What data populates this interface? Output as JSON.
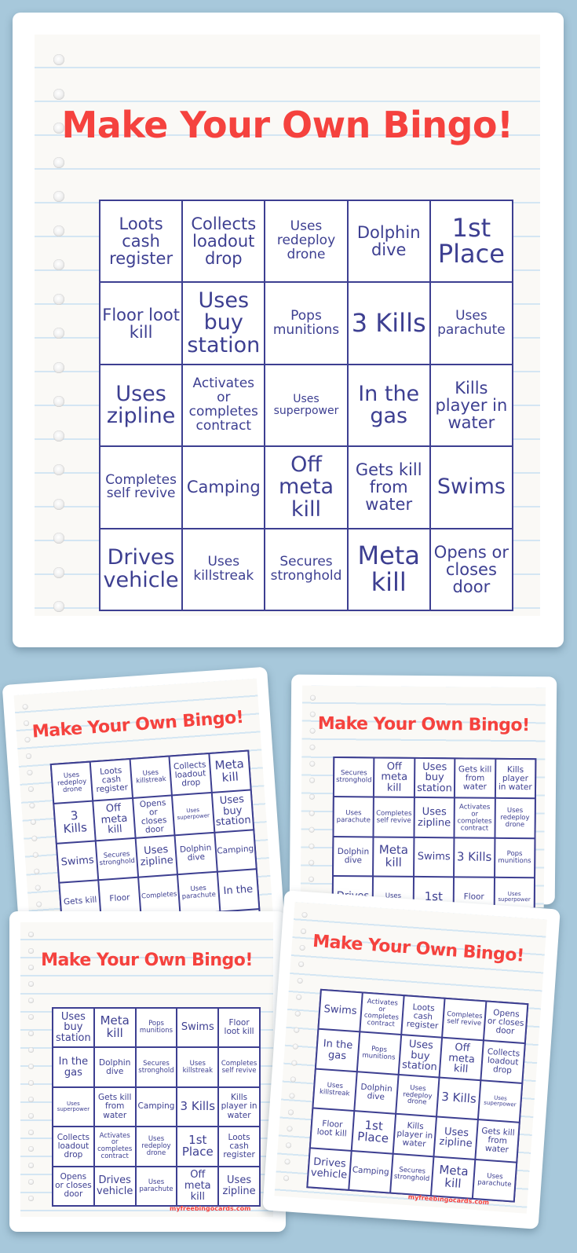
{
  "main": {
    "title": "Make Your Own Bingo!",
    "cells": [
      [
        "Loots cash register",
        "Collects loadout drop",
        "Uses redeploy drone",
        "Dolphin dive",
        "1st Place"
      ],
      [
        "Floor loot kill",
        "Uses buy station",
        "Pops munitions",
        "3 Kills",
        "Uses parachute"
      ],
      [
        "Uses zipline",
        "Activates or completes contract",
        "Uses superpower",
        "In the gas",
        "Kills player in water"
      ],
      [
        "Completes self revive",
        "Camping",
        "Off meta kill",
        "Gets kill from water",
        "Swims"
      ],
      [
        "Drives vehicle",
        "Uses killstreak",
        "Secures stronghold",
        "Meta kill",
        "Opens or closes door"
      ]
    ]
  },
  "cards": [
    {
      "title": "Make Your Own Bingo!",
      "cells": [
        [
          "Uses redeploy drone",
          "Loots cash register",
          "Uses killstreak",
          "Collects loadout drop",
          "Meta kill"
        ],
        [
          "3 Kills",
          "Off meta kill",
          "Opens or closes door",
          "Uses superpower",
          "Uses buy station"
        ],
        [
          "Swims",
          "Secures stronghold",
          "Uses zipline",
          "Dolphin dive",
          "Camping"
        ],
        [
          "Gets kill",
          "Floor",
          "Completes",
          "Uses parachute",
          "In the"
        ],
        [
          "",
          "",
          "",
          "",
          ""
        ]
      ]
    },
    {
      "title": "Make Your Own Bingo!",
      "cells": [
        [
          "Secures stronghold",
          "Off meta kill",
          "Uses buy station",
          "Gets kill from water",
          "Kills player in water"
        ],
        [
          "Uses parachute",
          "Completes self revive",
          "Uses zipline",
          "Activates or completes contract",
          "Uses redeploy drone"
        ],
        [
          "Dolphin dive",
          "Meta kill",
          "Swims",
          "3 Kills",
          "Pops munitions"
        ],
        [
          "Drives",
          "Uses",
          "1st",
          "Floor",
          "Uses superpower"
        ],
        [
          "",
          "",
          "",
          "",
          ""
        ]
      ]
    },
    {
      "title": "Make Your Own Bingo!",
      "watermark": "myfreebingocards.com",
      "cells": [
        [
          "Uses buy station",
          "Meta kill",
          "Pops munitions",
          "Swims",
          "Floor loot kill"
        ],
        [
          "In the gas",
          "Dolphin dive",
          "Secures stronghold",
          "Uses killstreak",
          "Completes self revive"
        ],
        [
          "Uses superpower",
          "Gets kill from water",
          "Camping",
          "3 Kills",
          "Kills player in water"
        ],
        [
          "Collects loadout drop",
          "Activates or completes contract",
          "Uses redeploy drone",
          "1st Place",
          "Loots cash register"
        ],
        [
          "Opens or closes door",
          "Drives vehicle",
          "Uses parachute",
          "Off meta kill",
          "Uses zipline"
        ]
      ]
    },
    {
      "title": "Make Your Own Bingo!",
      "watermark": "myfreebingocards.com",
      "cells": [
        [
          "Swims",
          "Activates or completes contract",
          "Loots cash register",
          "Completes self revive",
          "Opens or closes door"
        ],
        [
          "In the gas",
          "Pops munitions",
          "Uses buy station",
          "Off meta kill",
          "Collects loadout drop"
        ],
        [
          "Uses killstreak",
          "Dolphin dive",
          "Uses redeploy drone",
          "3 Kills",
          "Uses superpower"
        ],
        [
          "Floor loot kill",
          "1st Place",
          "Kills player in water",
          "Uses zipline",
          "Gets kill from water"
        ],
        [
          "Drives vehicle",
          "Camping",
          "Secures stronghold",
          "Meta kill",
          "Uses parachute"
        ]
      ]
    }
  ],
  "sizes": {
    "Loots cash register": 3,
    "Collects loadout drop": 3,
    "Uses redeploy drone": 2,
    "Dolphin dive": 3,
    "1st Place": 5,
    "Floor loot kill": 3,
    "Uses buy station": 4,
    "Pops munitions": 2,
    "3 Kills": 5,
    "Uses parachute": 2,
    "Uses zipline": 4,
    "Activates or completes contract": 2,
    "Uses superpower": 1,
    "In the gas": 4,
    "Kills player in water": 3,
    "Completes self revive": 2,
    "Camping": 3,
    "Off meta kill": 4,
    "Gets kill from water": 3,
    "Swims": 4,
    "Drives vehicle": 4,
    "Uses killstreak": 2,
    "Secures stronghold": 2,
    "Meta kill": 5,
    "Opens or closes door": 3,
    "Gets kill": 3,
    "Floor": 3,
    "Completes": 2,
    "In the": 4,
    "Drives": 4,
    "Uses": 2,
    "1st": 5
  },
  "colors": {
    "background": "#a7c8db",
    "title": "#f5423e",
    "grid": "#3d3f91",
    "ruled_line": "#d4e6f3",
    "paper": "#faf9f6"
  }
}
